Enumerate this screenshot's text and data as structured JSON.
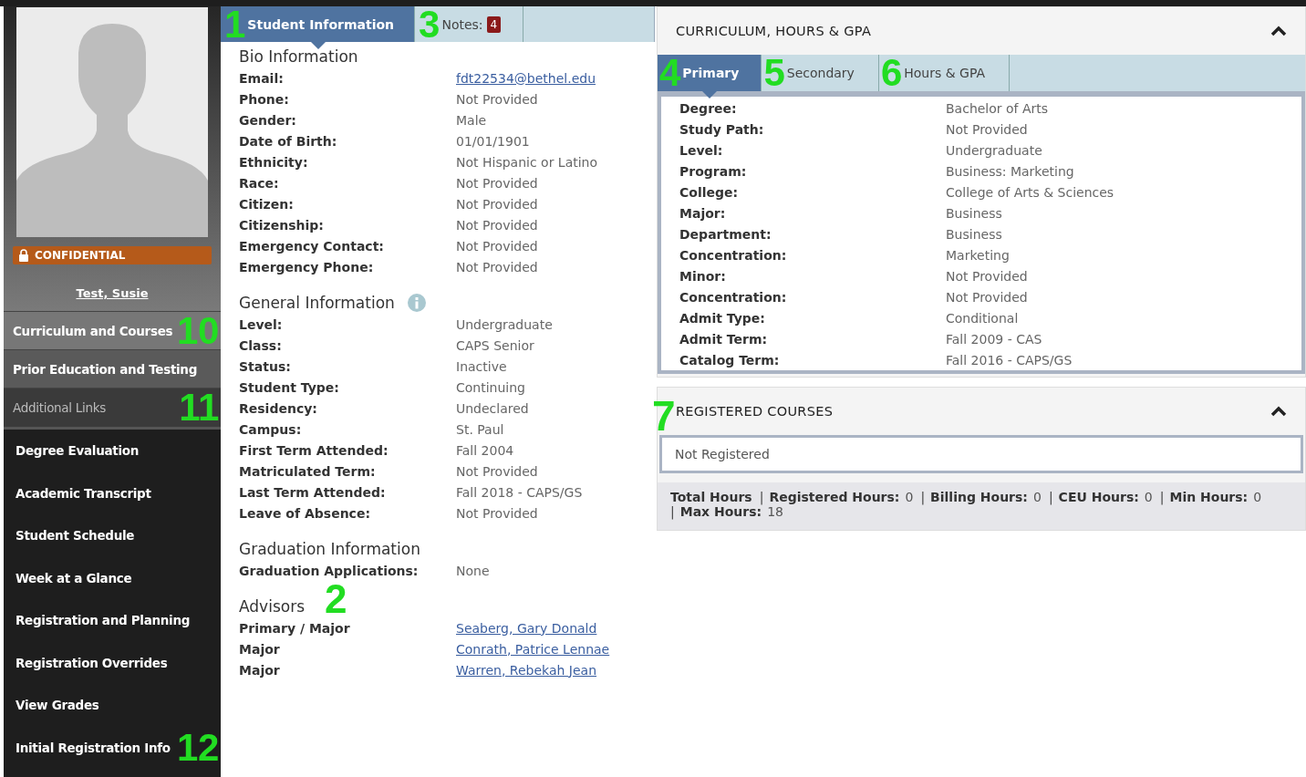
{
  "sidebar": {
    "badge": "CONFIDENTIAL",
    "student_name": "Test, Susie",
    "items": [
      {
        "label": "Curriculum and Courses",
        "kind": "section",
        "selected": true,
        "marker": "10"
      },
      {
        "label": "Prior Education and Testing",
        "kind": "section",
        "selected": false
      },
      {
        "label": "Additional Links",
        "kind": "header",
        "selected": false,
        "marker": "11"
      },
      {
        "label": "Degree Evaluation",
        "kind": "link",
        "selected": false
      },
      {
        "label": "Academic Transcript",
        "kind": "link",
        "selected": false
      },
      {
        "label": "Student Schedule",
        "kind": "link",
        "selected": false
      },
      {
        "label": "Week at a Glance",
        "kind": "link",
        "selected": false
      },
      {
        "label": "Registration and Planning",
        "kind": "link",
        "selected": false
      },
      {
        "label": "Registration Overrides",
        "kind": "link",
        "selected": false
      },
      {
        "label": "View Grades",
        "kind": "link",
        "selected": false
      },
      {
        "label": "Initial Registration Info",
        "kind": "link",
        "selected": false,
        "marker": "12"
      }
    ]
  },
  "main_tabs": [
    {
      "label": "Student Information",
      "selected": true,
      "marker": "1"
    },
    {
      "label": "Notes:",
      "badge": "4",
      "selected": false,
      "marker": "3"
    }
  ],
  "sections": [
    {
      "title": "Bio Information",
      "rows": [
        {
          "label": "Email:",
          "value": "fdt22534@bethel.edu",
          "kind": "link"
        },
        {
          "label": "Phone:",
          "value": "Not Provided",
          "kind": "text"
        },
        {
          "label": "Gender:",
          "value": "Male",
          "kind": "text"
        },
        {
          "label": "Date of Birth:",
          "value": "01/01/1901",
          "kind": "text"
        },
        {
          "label": "Ethnicity:",
          "value": "Not Hispanic or Latino",
          "kind": "text"
        },
        {
          "label": "Race:",
          "value": "Not Provided",
          "kind": "text"
        },
        {
          "label": "Citizen:",
          "value": "Not Provided",
          "kind": "text"
        },
        {
          "label": "Citizenship:",
          "value": "Not Provided",
          "kind": "text"
        },
        {
          "label": "Emergency Contact:",
          "value": "Not Provided",
          "kind": "text"
        },
        {
          "label": "Emergency Phone:",
          "value": "Not Provided",
          "kind": "text"
        }
      ]
    },
    {
      "title": "General Information",
      "info": true,
      "rows": [
        {
          "label": "Level:",
          "value": "Undergraduate",
          "kind": "text"
        },
        {
          "label": "Class:",
          "value": "CAPS Senior",
          "kind": "text"
        },
        {
          "label": "Status:",
          "value": "Inactive",
          "kind": "text"
        },
        {
          "label": "Student Type:",
          "value": "Continuing",
          "kind": "text"
        },
        {
          "label": "Residency:",
          "value": "Undeclared",
          "kind": "text"
        },
        {
          "label": "Campus:",
          "value": "St. Paul",
          "kind": "text"
        },
        {
          "label": "First Term Attended:",
          "value": "Fall 2004",
          "kind": "text"
        },
        {
          "label": "Matriculated Term:",
          "value": "Not Provided",
          "kind": "text"
        },
        {
          "label": "Last Term Attended:",
          "value": "Fall 2018 - CAPS/GS",
          "kind": "text"
        },
        {
          "label": "Leave of Absence:",
          "value": "Not Provided",
          "kind": "text"
        }
      ]
    },
    {
      "title": "Graduation Information",
      "rows": [
        {
          "label": "Graduation Applications:",
          "value": "None",
          "kind": "text"
        }
      ]
    },
    {
      "title": "Advisors",
      "marker": "2",
      "rows": [
        {
          "label": "Primary / Major",
          "value": "Seaberg, Gary Donald",
          "kind": "link"
        },
        {
          "label": "Major",
          "value": "Conrath, Patrice Lennae",
          "kind": "link"
        },
        {
          "label": "Major",
          "value": "Warren, Rebekah Jean",
          "kind": "link"
        }
      ]
    }
  ],
  "curriculum": {
    "title": "CURRICULUM, HOURS & GPA",
    "expanded": true,
    "tabs": [
      {
        "label": "Primary",
        "selected": true,
        "marker": "4"
      },
      {
        "label": "Secondary",
        "selected": false,
        "marker": "5"
      },
      {
        "label": "Hours & GPA",
        "selected": false,
        "marker": "6"
      }
    ],
    "rows": [
      {
        "label": "Degree:",
        "value": "Bachelor of Arts"
      },
      {
        "label": "Study Path:",
        "value": "Not Provided"
      },
      {
        "label": "Level:",
        "value": "Undergraduate"
      },
      {
        "label": "Program:",
        "value": "Business: Marketing"
      },
      {
        "label": "College:",
        "value": "College of Arts & Sciences"
      },
      {
        "label": "Major:",
        "value": "Business"
      },
      {
        "label": "Department:",
        "value": "Business"
      },
      {
        "label": "Concentration:",
        "value": "Marketing"
      },
      {
        "label": "Minor:",
        "value": "Not Provided"
      },
      {
        "label": "Concentration:",
        "value": "Not Provided"
      },
      {
        "label": "Admit Type:",
        "value": "Conditional"
      },
      {
        "label": "Admit Term:",
        "value": "Fall 2009 - CAS"
      },
      {
        "label": "Catalog Term:",
        "value": "Fall 2016 - CAPS/GS"
      }
    ]
  },
  "registered": {
    "title": "REGISTERED COURSES",
    "expanded": true,
    "marker": "7",
    "message": "Not Registered",
    "totals": [
      {
        "label": "Total Hours"
      },
      {
        "separator": "|",
        "label": "Registered Hours:",
        "value": "0"
      },
      {
        "separator": "|",
        "label": "Billing Hours:",
        "value": "0"
      },
      {
        "separator": "|",
        "label": "CEU Hours:",
        "value": "0"
      },
      {
        "separator": "|",
        "label": "Min Hours:",
        "value": "0"
      },
      {
        "separator": "|",
        "label": "Max Hours:",
        "value": "18"
      }
    ]
  }
}
